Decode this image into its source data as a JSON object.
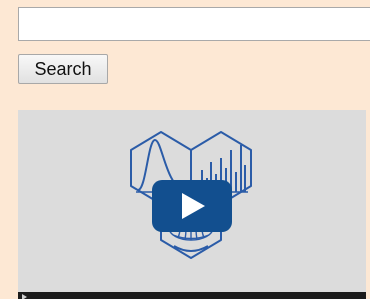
{
  "search": {
    "value": "",
    "placeholder": "",
    "button_label": "Search"
  },
  "video": {
    "brand_color": "#124f8f",
    "logo_color": "#2b5ca8",
    "icons": [
      "play-icon",
      "hexagon-logo-icon",
      "control-play-icon"
    ]
  }
}
